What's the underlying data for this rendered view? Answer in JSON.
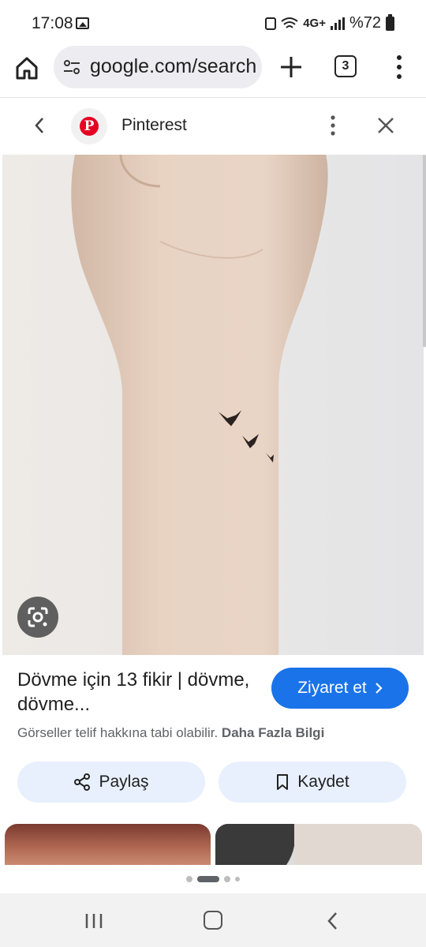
{
  "status_bar": {
    "time": "17:08",
    "network_label": "4G+",
    "battery": "%72"
  },
  "browser": {
    "url": "google.com/search",
    "tab_count": "3"
  },
  "sheet": {
    "source_name": "Pinterest",
    "title": "Dövme için 13 fikir | dövme, dövme...",
    "visit_label": "Ziyaret et",
    "copyright_text": "Görseller telif hakkına tabi olabilir.",
    "learn_more": "Daha Fazla Bilgi",
    "share_label": "Paylaş",
    "save_label": "Kaydet"
  },
  "colors": {
    "accent": "#1a73e8",
    "pinterest": "#e60023",
    "pill_bg": "#e8f0fe"
  }
}
